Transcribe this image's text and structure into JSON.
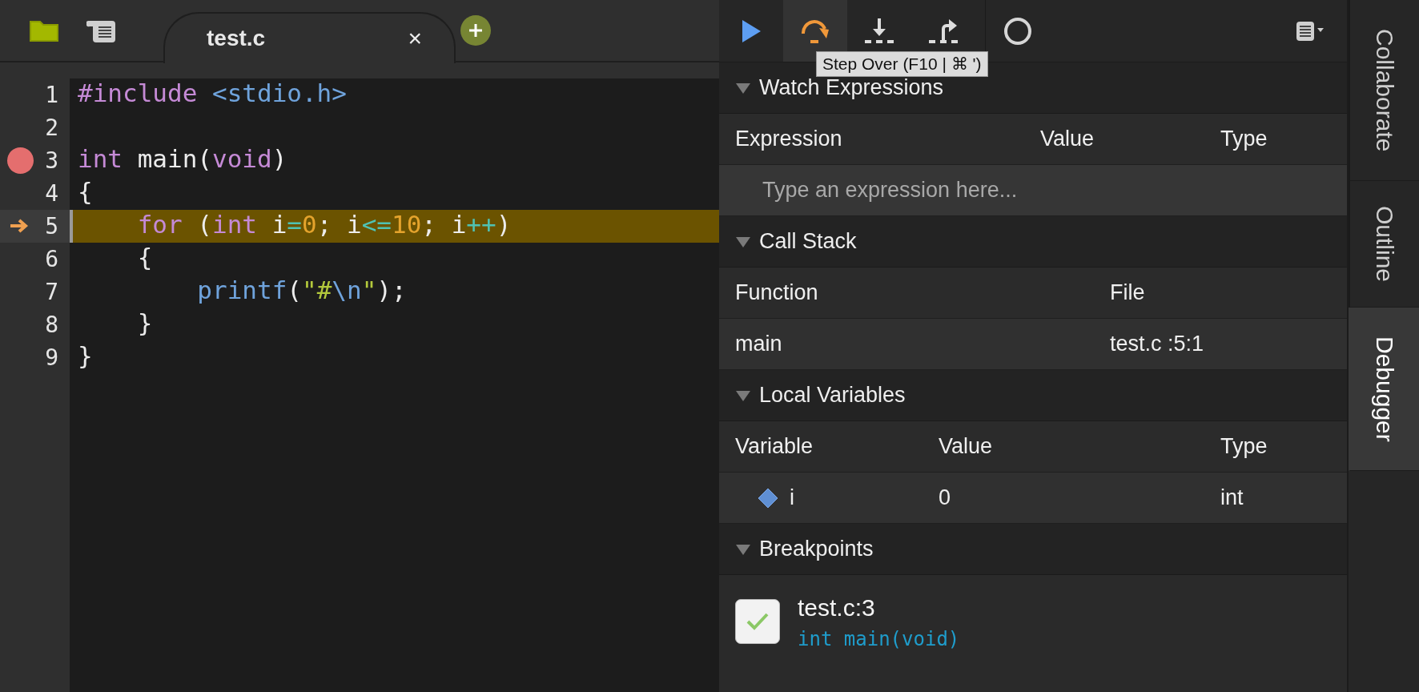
{
  "editor": {
    "tabs": [
      {
        "label": "test.c",
        "selected": true,
        "close": "×"
      }
    ],
    "lines": [
      {
        "number": "1",
        "breakpoint": false,
        "current": false,
        "tokens": [
          {
            "text": "#include",
            "kind": "keyword"
          },
          {
            "text": " <stdio.h>",
            "kind": "header"
          }
        ]
      },
      {
        "number": "2",
        "breakpoint": false,
        "current": false
      },
      {
        "number": "3",
        "breakpoint": true,
        "current": false,
        "tokens": [
          {
            "text": "int",
            "kind": "keyword"
          },
          {
            "text": " main(",
            "kind": "plain"
          },
          {
            "text": "void",
            "kind": "keyword"
          },
          {
            "text": ")",
            "kind": "plain"
          }
        ]
      },
      {
        "number": "4",
        "breakpoint": false,
        "current": false,
        "tokens": [
          {
            "text": "{",
            "kind": "plain"
          }
        ]
      },
      {
        "number": "5",
        "breakpoint": false,
        "current": true,
        "tokens": [
          {
            "text": "    for",
            "kind": "keyword"
          },
          {
            "text": " (",
            "kind": "plain"
          },
          {
            "text": "int",
            "kind": "keyword"
          },
          {
            "text": " i",
            "kind": "plain"
          },
          {
            "text": "=",
            "kind": "operator"
          },
          {
            "text": "0",
            "kind": "number"
          },
          {
            "text": "; i",
            "kind": "plain"
          },
          {
            "text": "<=",
            "kind": "operator"
          },
          {
            "text": "10",
            "kind": "number"
          },
          {
            "text": "; i",
            "kind": "plain"
          },
          {
            "text": "++",
            "kind": "operator"
          },
          {
            "text": ")",
            "kind": "plain"
          }
        ]
      },
      {
        "number": "6",
        "breakpoint": false,
        "current": false,
        "tokens": [
          {
            "text": "    {",
            "kind": "plain"
          }
        ]
      },
      {
        "number": "7",
        "breakpoint": false,
        "current": false,
        "tokens": [
          {
            "text": "        printf",
            "kind": "function"
          },
          {
            "text": "(",
            "kind": "plain"
          },
          {
            "text": "\"#",
            "kind": "string"
          },
          {
            "text": "\\n",
            "kind": "escape"
          },
          {
            "text": "\"",
            "kind": "string"
          },
          {
            "text": ");",
            "kind": "plain"
          }
        ]
      },
      {
        "number": "8",
        "breakpoint": false,
        "current": false,
        "tokens": [
          {
            "text": "    }",
            "kind": "plain"
          }
        ]
      },
      {
        "number": "9",
        "breakpoint": false,
        "current": false,
        "tokens": [
          {
            "text": "}",
            "kind": "plain"
          }
        ]
      }
    ]
  },
  "debugger": {
    "toolbar": [
      {
        "kind": "continue",
        "highlighted": false
      },
      {
        "kind": "step-over",
        "highlighted": true
      },
      {
        "kind": "step-into",
        "highlighted": false
      },
      {
        "kind": "step-out",
        "highlighted": false
      },
      {
        "kind": "breakpoints-toggle",
        "highlighted": false
      }
    ],
    "tooltip": "Step Over (F10 | ⌘ ')",
    "sections": [
      {
        "kind": "watch",
        "title": "Watch Expressions",
        "expanded": true,
        "columns": [
          "Expression",
          "Value",
          "Type"
        ],
        "placeholder": "Type an expression here..."
      },
      {
        "kind": "call-stack",
        "title": "Call Stack",
        "expanded": true,
        "columns": [
          "Function",
          "File"
        ],
        "rows": [
          [
            "main",
            "test.c :5:1"
          ]
        ]
      },
      {
        "kind": "variables",
        "title": "Local Variables",
        "expanded": true,
        "columns": [
          "Variable",
          "Value",
          "Type"
        ],
        "rows": [
          [
            "i",
            "0",
            "int"
          ]
        ]
      },
      {
        "kind": "breakpoints",
        "title": "Breakpoints",
        "expanded": true,
        "items": [
          {
            "checked": true,
            "location": "test.c:3",
            "code": "int main(void)"
          }
        ]
      }
    ]
  },
  "side_tabs": [
    {
      "label": "Collaborate",
      "selected": false
    },
    {
      "label": "Outline",
      "selected": false
    },
    {
      "label": "Debugger",
      "selected": true
    }
  ]
}
